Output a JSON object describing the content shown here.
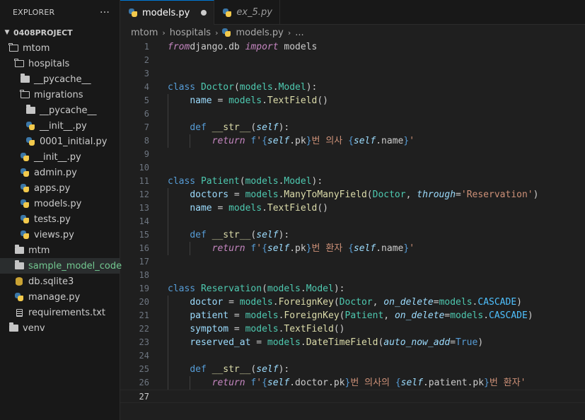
{
  "explorer": {
    "title": "EXPLORER",
    "more": "···",
    "project": "0408PROJECT",
    "items": [
      {
        "label": "mtom",
        "icon": "folder-open-icon",
        "depth": 1
      },
      {
        "label": "hospitals",
        "icon": "folder-open-icon",
        "depth": 2
      },
      {
        "label": "__pycache__",
        "icon": "folder-closed-icon",
        "depth": 3
      },
      {
        "label": "migrations",
        "icon": "folder-open-icon",
        "depth": 3
      },
      {
        "label": "__pycache__",
        "icon": "folder-closed-icon",
        "depth": 4
      },
      {
        "label": "__init__.py",
        "icon": "python-icon",
        "depth": 4
      },
      {
        "label": "0001_initial.py",
        "icon": "python-icon",
        "depth": 4
      },
      {
        "label": "__init__.py",
        "icon": "python-icon",
        "depth": 3
      },
      {
        "label": "admin.py",
        "icon": "python-icon",
        "depth": 3
      },
      {
        "label": "apps.py",
        "icon": "python-icon",
        "depth": 3
      },
      {
        "label": "models.py",
        "icon": "python-icon",
        "depth": 3
      },
      {
        "label": "tests.py",
        "icon": "python-icon",
        "depth": 3
      },
      {
        "label": "views.py",
        "icon": "python-icon",
        "depth": 3
      },
      {
        "label": "mtm",
        "icon": "folder-closed-icon",
        "depth": 2
      },
      {
        "label": "sample_model_code",
        "icon": "folder-closed-icon",
        "depth": 2,
        "selected": true
      },
      {
        "label": "db.sqlite3",
        "icon": "database-icon",
        "depth": 2
      },
      {
        "label": "manage.py",
        "icon": "python-icon",
        "depth": 2
      },
      {
        "label": "requirements.txt",
        "icon": "text-file-icon",
        "depth": 2
      },
      {
        "label": "venv",
        "icon": "folder-closed-icon",
        "depth": 1
      }
    ]
  },
  "tabs": [
    {
      "label": "models.py",
      "active": true,
      "dirty": true
    },
    {
      "label": "ex_5.py",
      "active": false,
      "dirty": false
    }
  ],
  "breadcrumb": {
    "parts": [
      "mtom",
      "hospitals"
    ],
    "file": "models.py",
    "ellipsis": "..."
  },
  "editor": {
    "current_line": 27,
    "lines": [
      {
        "n": "1",
        "tokens": [
          [
            "kwi",
            "from"
          ],
          [
            "",
            "django.db "
          ],
          [
            "kwi",
            "import"
          ],
          [
            "",
            " models"
          ]
        ]
      },
      {
        "n": "2",
        "tokens": []
      },
      {
        "n": "3",
        "tokens": []
      },
      {
        "n": "4",
        "tokens": [
          [
            "kw",
            "class"
          ],
          [
            "",
            " "
          ],
          [
            "cls",
            "Doctor"
          ],
          [
            "",
            "("
          ],
          [
            "cls",
            "models"
          ],
          [
            "",
            "."
          ],
          [
            "cls",
            "Model"
          ],
          [
            "",
            "):"
          ]
        ]
      },
      {
        "n": "5",
        "indent": 1,
        "tokens": [
          [
            "",
            "    "
          ],
          [
            "var",
            "name"
          ],
          [
            "",
            " = "
          ],
          [
            "cls",
            "models"
          ],
          [
            "",
            "."
          ],
          [
            "fn",
            "TextField"
          ],
          [
            "",
            "()"
          ]
        ]
      },
      {
        "n": "6",
        "indent": 1,
        "tokens": []
      },
      {
        "n": "7",
        "indent": 1,
        "tokens": [
          [
            "",
            "    "
          ],
          [
            "kw",
            "def"
          ],
          [
            "",
            " "
          ],
          [
            "fn",
            "__str__"
          ],
          [
            "",
            "("
          ],
          [
            "slf",
            "self"
          ],
          [
            "",
            "):"
          ]
        ]
      },
      {
        "n": "8",
        "indent": 2,
        "tokens": [
          [
            "",
            "        "
          ],
          [
            "kwi",
            "return"
          ],
          [
            "",
            " "
          ],
          [
            "kw",
            "f"
          ],
          [
            "str",
            "'"
          ],
          [
            "brc",
            "{"
          ],
          [
            "slf",
            "self"
          ],
          [
            "",
            ".pk"
          ],
          [
            "brc",
            "}"
          ],
          [
            "str",
            "번 의사 "
          ],
          [
            "brc",
            "{"
          ],
          [
            "slf",
            "self"
          ],
          [
            "",
            ".name"
          ],
          [
            "brc",
            "}"
          ],
          [
            "str",
            "'"
          ]
        ]
      },
      {
        "n": "9",
        "tokens": []
      },
      {
        "n": "10",
        "tokens": []
      },
      {
        "n": "11",
        "tokens": [
          [
            "kw",
            "class"
          ],
          [
            "",
            " "
          ],
          [
            "cls",
            "Patient"
          ],
          [
            "",
            "("
          ],
          [
            "cls",
            "models"
          ],
          [
            "",
            "."
          ],
          [
            "cls",
            "Model"
          ],
          [
            "",
            "):"
          ]
        ]
      },
      {
        "n": "12",
        "indent": 1,
        "tokens": [
          [
            "",
            "    "
          ],
          [
            "var",
            "doctors"
          ],
          [
            "",
            " = "
          ],
          [
            "cls",
            "models"
          ],
          [
            "",
            "."
          ],
          [
            "fn",
            "ManyToManyField"
          ],
          [
            "",
            "("
          ],
          [
            "cls",
            "Doctor"
          ],
          [
            "",
            ", "
          ],
          [
            "prm",
            "through"
          ],
          [
            "",
            "="
          ],
          [
            "str",
            "'Reservation'"
          ],
          [
            "",
            ")"
          ]
        ]
      },
      {
        "n": "13",
        "indent": 1,
        "tokens": [
          [
            "",
            "    "
          ],
          [
            "var",
            "name"
          ],
          [
            "",
            " = "
          ],
          [
            "cls",
            "models"
          ],
          [
            "",
            "."
          ],
          [
            "fn",
            "TextField"
          ],
          [
            "",
            "()"
          ]
        ]
      },
      {
        "n": "14",
        "indent": 1,
        "tokens": []
      },
      {
        "n": "15",
        "indent": 1,
        "tokens": [
          [
            "",
            "    "
          ],
          [
            "kw",
            "def"
          ],
          [
            "",
            " "
          ],
          [
            "fn",
            "__str__"
          ],
          [
            "",
            "("
          ],
          [
            "slf",
            "self"
          ],
          [
            "",
            "):"
          ]
        ]
      },
      {
        "n": "16",
        "indent": 2,
        "tokens": [
          [
            "",
            "        "
          ],
          [
            "kwi",
            "return"
          ],
          [
            "",
            " "
          ],
          [
            "kw",
            "f"
          ],
          [
            "str",
            "'"
          ],
          [
            "brc",
            "{"
          ],
          [
            "slf",
            "self"
          ],
          [
            "",
            ".pk"
          ],
          [
            "brc",
            "}"
          ],
          [
            "str",
            "번 환자 "
          ],
          [
            "brc",
            "{"
          ],
          [
            "slf",
            "self"
          ],
          [
            "",
            ".name"
          ],
          [
            "brc",
            "}"
          ],
          [
            "str",
            "'"
          ]
        ]
      },
      {
        "n": "17",
        "tokens": []
      },
      {
        "n": "18",
        "tokens": []
      },
      {
        "n": "19",
        "tokens": [
          [
            "kw",
            "class"
          ],
          [
            "",
            " "
          ],
          [
            "cls",
            "Reservation"
          ],
          [
            "",
            "("
          ],
          [
            "cls",
            "models"
          ],
          [
            "",
            "."
          ],
          [
            "cls",
            "Model"
          ],
          [
            "",
            "):"
          ]
        ]
      },
      {
        "n": "20",
        "indent": 1,
        "tokens": [
          [
            "",
            "    "
          ],
          [
            "var",
            "doctor"
          ],
          [
            "",
            " = "
          ],
          [
            "cls",
            "models"
          ],
          [
            "",
            "."
          ],
          [
            "fn",
            "ForeignKey"
          ],
          [
            "",
            "("
          ],
          [
            "cls",
            "Doctor"
          ],
          [
            "",
            ", "
          ],
          [
            "prm",
            "on_delete"
          ],
          [
            "",
            "="
          ],
          [
            "cls",
            "models"
          ],
          [
            "",
            "."
          ],
          [
            "cst",
            "CASCADE"
          ],
          [
            "",
            ")"
          ]
        ]
      },
      {
        "n": "21",
        "indent": 1,
        "tokens": [
          [
            "",
            "    "
          ],
          [
            "var",
            "patient"
          ],
          [
            "",
            " = "
          ],
          [
            "cls",
            "models"
          ],
          [
            "",
            "."
          ],
          [
            "fn",
            "ForeignKey"
          ],
          [
            "",
            "("
          ],
          [
            "cls",
            "Patient"
          ],
          [
            "",
            ", "
          ],
          [
            "prm",
            "on_delete"
          ],
          [
            "",
            "="
          ],
          [
            "cls",
            "models"
          ],
          [
            "",
            "."
          ],
          [
            "cst",
            "CASCADE"
          ],
          [
            "",
            ")"
          ]
        ]
      },
      {
        "n": "22",
        "indent": 1,
        "tokens": [
          [
            "",
            "    "
          ],
          [
            "var",
            "symptom"
          ],
          [
            "",
            " = "
          ],
          [
            "cls",
            "models"
          ],
          [
            "",
            "."
          ],
          [
            "fn",
            "TextField"
          ],
          [
            "",
            "()"
          ]
        ]
      },
      {
        "n": "23",
        "indent": 1,
        "tokens": [
          [
            "",
            "    "
          ],
          [
            "var",
            "reserved_at"
          ],
          [
            "",
            " = "
          ],
          [
            "cls",
            "models"
          ],
          [
            "",
            "."
          ],
          [
            "fn",
            "DateTimeField"
          ],
          [
            "",
            "("
          ],
          [
            "prm",
            "auto_now_add"
          ],
          [
            "",
            "="
          ],
          [
            "kw",
            "True"
          ],
          [
            "",
            ")"
          ]
        ]
      },
      {
        "n": "24",
        "indent": 1,
        "tokens": []
      },
      {
        "n": "25",
        "indent": 1,
        "tokens": [
          [
            "",
            "    "
          ],
          [
            "kw",
            "def"
          ],
          [
            "",
            " "
          ],
          [
            "fn",
            "__str__"
          ],
          [
            "",
            "("
          ],
          [
            "slf",
            "self"
          ],
          [
            "",
            "):"
          ]
        ]
      },
      {
        "n": "26",
        "indent": 2,
        "tokens": [
          [
            "",
            "        "
          ],
          [
            "kwi",
            "return"
          ],
          [
            "",
            " "
          ],
          [
            "kw",
            "f"
          ],
          [
            "str",
            "'"
          ],
          [
            "brc",
            "{"
          ],
          [
            "slf",
            "self"
          ],
          [
            "",
            ".doctor.pk"
          ],
          [
            "brc",
            "}"
          ],
          [
            "str",
            "번 의사의 "
          ],
          [
            "brc",
            "{"
          ],
          [
            "slf",
            "self"
          ],
          [
            "",
            ".patient.pk"
          ],
          [
            "brc",
            "}"
          ],
          [
            "str",
            "번 환자'"
          ]
        ]
      },
      {
        "n": "27",
        "tokens": []
      }
    ]
  }
}
